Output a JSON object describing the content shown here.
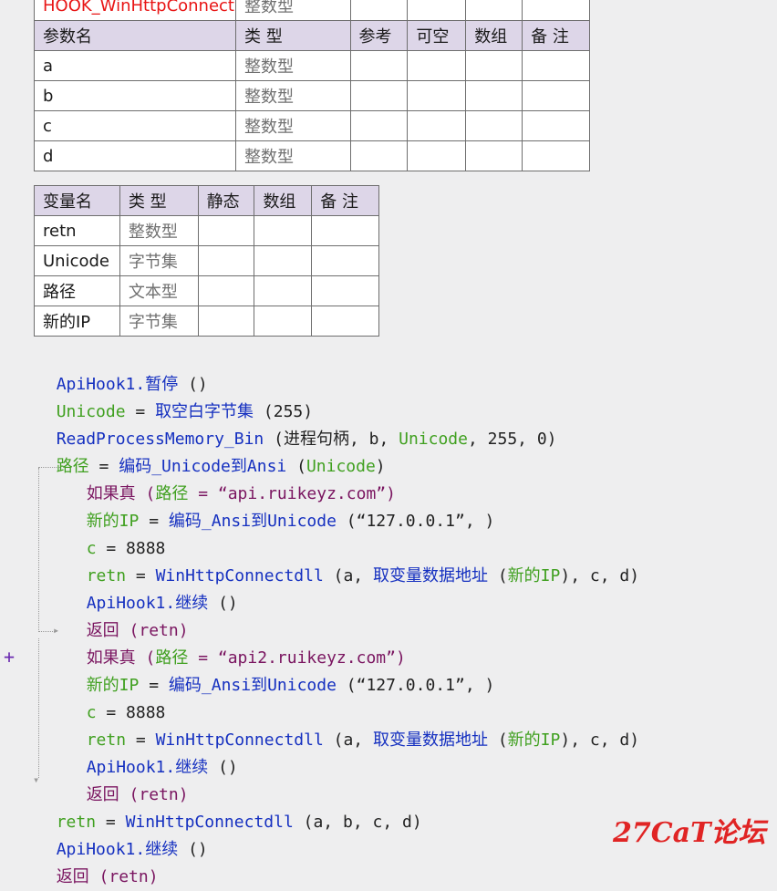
{
  "sub": {
    "name": "HOOK_WinHttpConnect",
    "return_type": "整数型",
    "param_headers": [
      "参数名",
      "类 型",
      "参考",
      "可空",
      "数组",
      "备 注"
    ],
    "params": [
      {
        "name": "a",
        "type": "整数型"
      },
      {
        "name": "b",
        "type": "整数型"
      },
      {
        "name": "c",
        "type": "整数型"
      },
      {
        "name": "d",
        "type": "整数型"
      }
    ]
  },
  "locals": {
    "headers": [
      "变量名",
      "类 型",
      "静态",
      "数组",
      "备 注"
    ],
    "rows": [
      {
        "name": "retn",
        "type": "整数型"
      },
      {
        "name": "Unicode",
        "type": "字节集"
      },
      {
        "name": "路径",
        "type": "文本型"
      },
      {
        "name": "新的IP",
        "type": "字节集"
      }
    ]
  },
  "code": {
    "l1": {
      "obj": "ApiHook1.",
      "fn": "暂停",
      "rest": " ()"
    },
    "l2": {
      "var": "Unicode",
      "op": " = ",
      "fn": "取空白字节集",
      "rest": " (255)"
    },
    "l3": {
      "fn": "ReadProcessMemory_Bin",
      "a1": " (进程句柄, b, ",
      "var": "Unicode",
      "rest": ", 255, 0)"
    },
    "l4": {
      "var": "路径",
      "op": " = ",
      "fn": "编码_Unicode到Ansi",
      "a1": " (",
      "var2": "Unicode",
      "rest": ")"
    },
    "l5": {
      "kw": "如果真",
      "a1": " (",
      "var": "路径",
      "rest": " = “api.ruikeyz.com”)"
    },
    "l6": {
      "var": "新的IP",
      "op": " = ",
      "fn": "编码_Ansi到Unicode",
      "rest": " (“127.0.0.1”, )"
    },
    "l7": {
      "var": "c",
      "rest": " = 8888"
    },
    "l8": {
      "var": "retn",
      "op": " = ",
      "fn": "WinHttpConnectdll",
      "a1": " (a, ",
      "fn2": "取变量数据地址",
      "a2": " (",
      "var2": "新的IP",
      "rest": "), c, d)"
    },
    "l9": {
      "obj": "ApiHook1.",
      "fn": "继续",
      "rest": " ()"
    },
    "l10": {
      "kw": "返回",
      "rest": " (retn)"
    },
    "l11": {
      "kw": "如果真",
      "a1": " (",
      "var": "路径",
      "rest": " = “api2.ruikeyz.com”)"
    },
    "l12": {
      "var": "新的IP",
      "op": " = ",
      "fn": "编码_Ansi到Unicode",
      "rest": " (“127.0.0.1”, )"
    },
    "l13": {
      "var": "c",
      "rest": " = 8888"
    },
    "l14": {
      "var": "retn",
      "op": " = ",
      "fn": "WinHttpConnectdll",
      "a1": " (a, ",
      "fn2": "取变量数据地址",
      "a2": " (",
      "var2": "新的IP",
      "rest": "), c, d)"
    },
    "l15": {
      "obj": "ApiHook1.",
      "fn": "继续",
      "rest": " ()"
    },
    "l16": {
      "kw": "返回",
      "rest": " (retn)"
    },
    "l17": {
      "var": "retn",
      "op": " = ",
      "fn": "WinHttpConnectdll",
      "rest": " (a, b, c, d)"
    },
    "l18": {
      "obj": "ApiHook1.",
      "fn": "继续",
      "rest": " ()"
    },
    "l19": {
      "kw": "返回",
      "rest": " (retn)"
    }
  },
  "margin_marker": "+",
  "watermark": "27CaT论坛",
  "colors": {
    "keyword": "#7a1560",
    "function": "#1530c0",
    "variable": "#40a020",
    "header_bg": "#ddd6e8",
    "sub_name": "#e81515"
  }
}
